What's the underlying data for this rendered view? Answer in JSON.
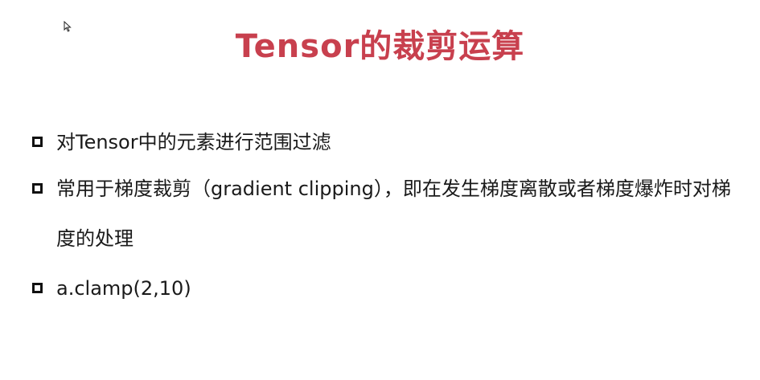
{
  "slide": {
    "title": "Tensor的裁剪运算",
    "bullets": [
      {
        "text": "对Tensor中的元素进行范围过滤",
        "icon": "square-bullet-icon"
      },
      {
        "text": "常用于梯度裁剪（gradient clipping），即在发生梯度离散或者梯度爆炸时对梯度的处理",
        "icon": "square-bullet-icon"
      },
      {
        "text": "a.clamp(2,10)",
        "icon": "square-bullet-icon"
      }
    ]
  },
  "colors": {
    "title": "#c8404e",
    "body_text": "#1a1a1a",
    "background": "#ffffff"
  },
  "cursor": {
    "icon": "mouse-pointer-icon"
  }
}
